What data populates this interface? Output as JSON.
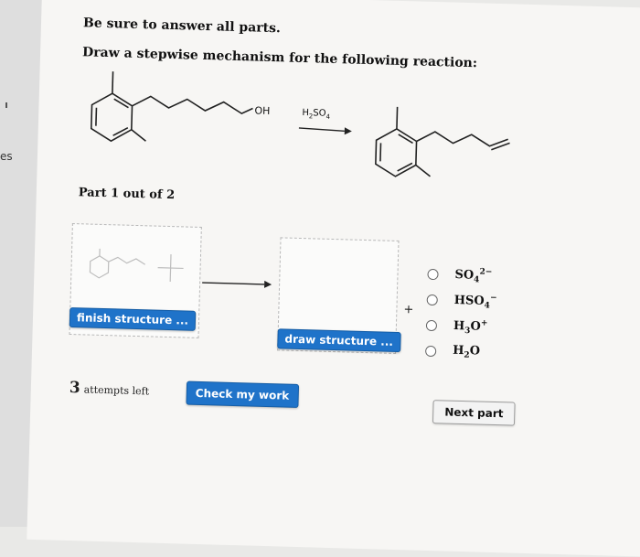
{
  "side_panel": {
    "tab_text": "es"
  },
  "header": {
    "line1": "Be sure to answer all parts.",
    "line2": "Draw a stepwise mechanism for the following reaction:"
  },
  "reaction": {
    "reactant_group": "OH",
    "reagent": "H2SO4"
  },
  "part": {
    "label": "Part 1 out of 2"
  },
  "mechanism": {
    "finish_button": "finish structure ...",
    "draw_button": "draw structure ...",
    "plus": "+"
  },
  "options": [
    {
      "base": "SO",
      "sub": "4",
      "sup": "2−"
    },
    {
      "base": "HSO",
      "sub": "4",
      "sup": "−"
    },
    {
      "base": "H",
      "sub": "3",
      "rest": "O",
      "sup": "+"
    },
    {
      "base": "H",
      "sub": "2",
      "rest": "O",
      "sup": ""
    }
  ],
  "footer": {
    "attempts_count": "3",
    "attempts_text": "attempts left",
    "check_button": "Check my work",
    "next_button": "Next part"
  }
}
